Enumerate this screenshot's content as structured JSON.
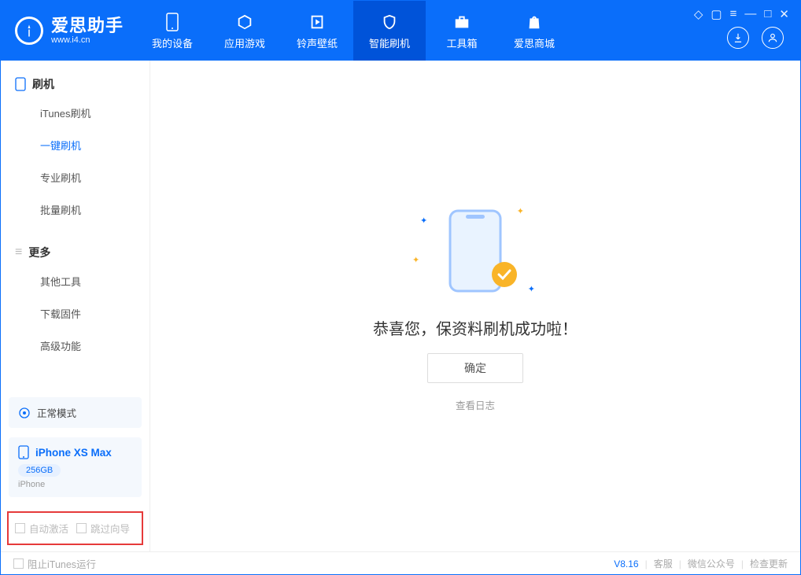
{
  "app": {
    "title": "爱思助手",
    "subtitle": "www.i4.cn"
  },
  "nav": {
    "items": [
      {
        "label": "我的设备"
      },
      {
        "label": "应用游戏"
      },
      {
        "label": "铃声壁纸"
      },
      {
        "label": "智能刷机"
      },
      {
        "label": "工具箱"
      },
      {
        "label": "爱思商城"
      }
    ]
  },
  "sidebar": {
    "section1_title": "刷机",
    "items1": [
      {
        "label": "iTunes刷机"
      },
      {
        "label": "一键刷机"
      },
      {
        "label": "专业刷机"
      },
      {
        "label": "批量刷机"
      }
    ],
    "section2_title": "更多",
    "items2": [
      {
        "label": "其他工具"
      },
      {
        "label": "下载固件"
      },
      {
        "label": "高级功能"
      }
    ]
  },
  "device": {
    "mode": "正常模式",
    "name": "iPhone XS Max",
    "capacity": "256GB",
    "type": "iPhone"
  },
  "options": {
    "auto_activate": "自动激活",
    "skip_guide": "跳过向导"
  },
  "main": {
    "success_msg": "恭喜您，保资料刷机成功啦！",
    "ok_label": "确定",
    "view_log": "查看日志"
  },
  "footer": {
    "block_itunes": "阻止iTunes运行",
    "version": "V8.16",
    "support": "客服",
    "wechat": "微信公众号",
    "check_update": "检查更新"
  }
}
